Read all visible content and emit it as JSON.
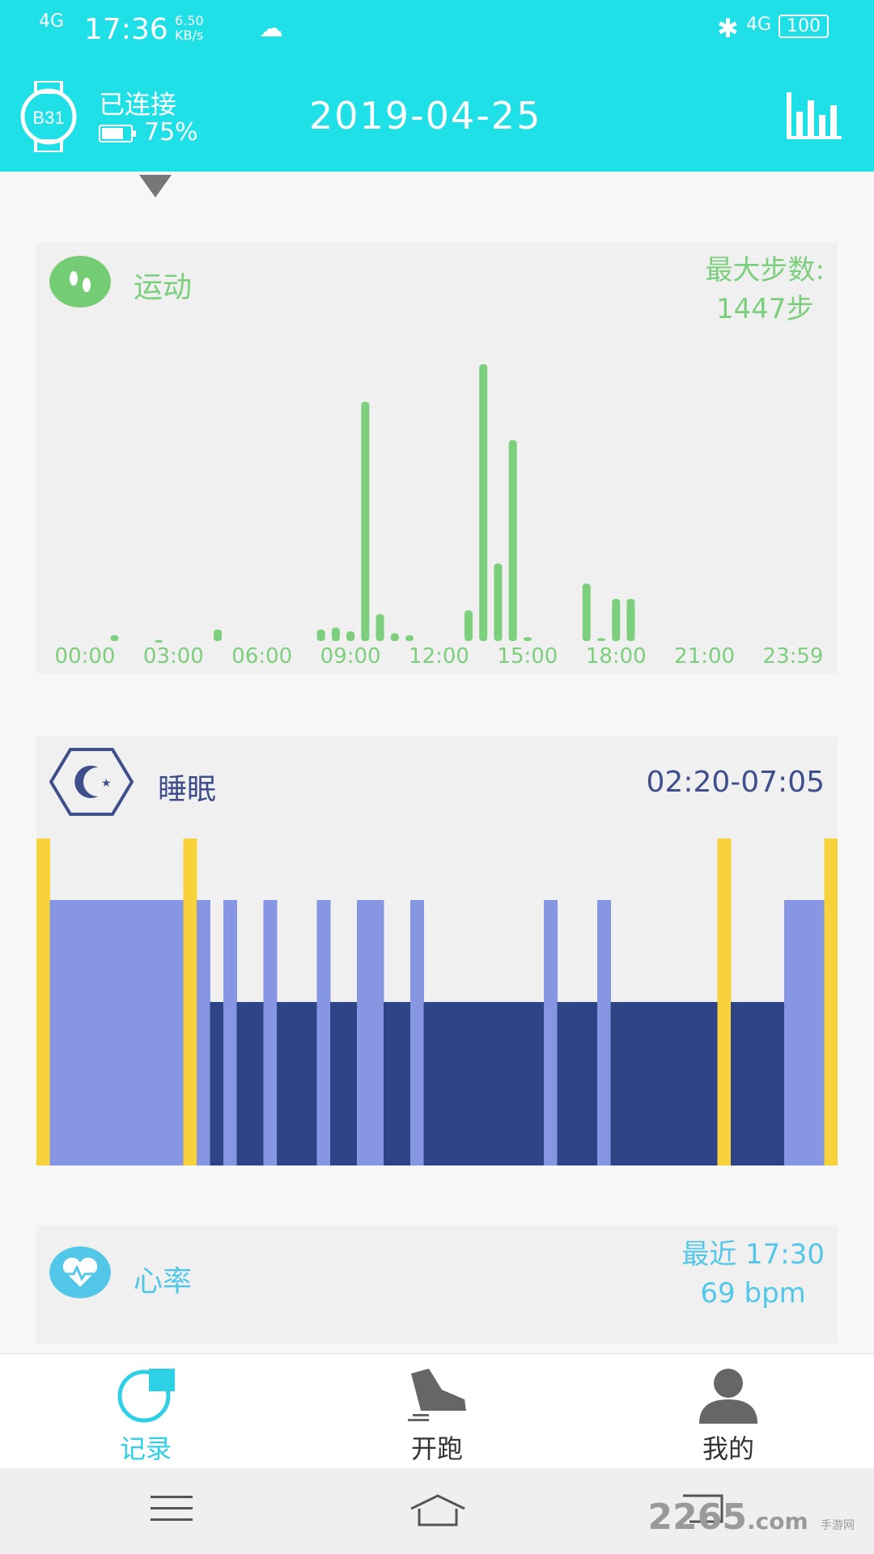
{
  "status_bar": {
    "network_left": "4G",
    "time": "17:36",
    "speed_value": "6.50",
    "speed_unit": "KB/s",
    "network_right": "4G",
    "battery": "100"
  },
  "header": {
    "device_name": "B31",
    "connection": "已连接",
    "battery_percent": "75%",
    "battery_level": 0.75,
    "date": "2019-04-25"
  },
  "steps_card": {
    "title": "运动",
    "max_label": "最大步数:",
    "max_value": "1447步",
    "color": "#7ccf7c"
  },
  "chart_data": {
    "type": "bar",
    "x_unit": "hour",
    "x_ticks": [
      "00:00",
      "03:00",
      "06:00",
      "09:00",
      "12:00",
      "15:00",
      "18:00",
      "21:00",
      "23:59"
    ],
    "series": [
      {
        "x": [
          1,
          2.5,
          4.5,
          8,
          8.5,
          9,
          9.5,
          10,
          10.5,
          11,
          13,
          13.5,
          14,
          14.5,
          15,
          17,
          17.5,
          18,
          18.5
        ],
        "values": [
          30,
          5,
          60,
          60,
          70,
          50,
          1250,
          140,
          40,
          30,
          160,
          1447,
          405,
          1050,
          20,
          300,
          15,
          220,
          220
        ]
      }
    ]
  },
  "sleep_card": {
    "title": "睡眠",
    "range": "02:20-07:05"
  },
  "sleep_data": {
    "levels": [
      "awake",
      "light",
      "deep"
    ],
    "colors": {
      "awake": "#f7d23b",
      "light": "#8796e3",
      "deep": "#2e4487"
    },
    "segments": [
      {
        "t": "awake",
        "d": 1
      },
      {
        "t": "light",
        "d": 10
      },
      {
        "t": "awake",
        "d": 1
      },
      {
        "t": "light",
        "d": 1
      },
      {
        "t": "deep",
        "d": 1
      },
      {
        "t": "light",
        "d": 1
      },
      {
        "t": "deep",
        "d": 2
      },
      {
        "t": "light",
        "d": 1
      },
      {
        "t": "deep",
        "d": 3
      },
      {
        "t": "light",
        "d": 1
      },
      {
        "t": "deep",
        "d": 2
      },
      {
        "t": "light",
        "d": 2
      },
      {
        "t": "deep",
        "d": 2
      },
      {
        "t": "light",
        "d": 1
      },
      {
        "t": "deep",
        "d": 9
      },
      {
        "t": "light",
        "d": 1
      },
      {
        "t": "deep",
        "d": 3
      },
      {
        "t": "light",
        "d": 1
      },
      {
        "t": "deep",
        "d": 8
      },
      {
        "t": "awake",
        "d": 1
      },
      {
        "t": "deep",
        "d": 4
      },
      {
        "t": "light",
        "d": 3
      },
      {
        "t": "awake",
        "d": 1
      }
    ]
  },
  "heart_card": {
    "title": "心率",
    "recent": "最近 17:30",
    "bpm": "69 bpm"
  },
  "tabs": [
    {
      "label": "记录",
      "color": "#2ed0e6"
    },
    {
      "label": "开跑",
      "color": "#333333"
    },
    {
      "label": "我的",
      "color": "#333333"
    }
  ],
  "watermark": {
    "brand": "2265",
    "suffix": ".com",
    "sub": "手游网"
  }
}
